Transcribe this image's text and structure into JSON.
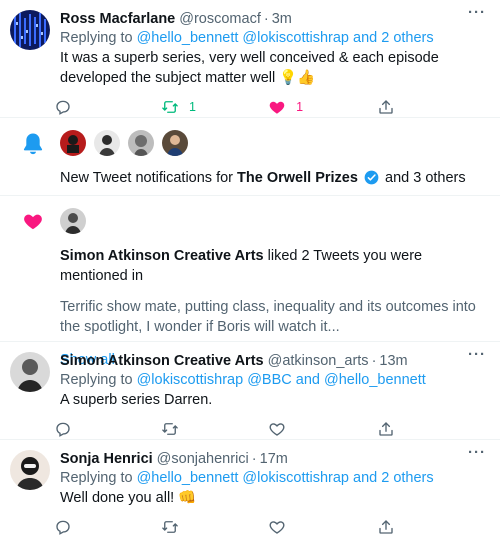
{
  "tweets": [
    {
      "name": "Ross Macfarlane",
      "handle": "@roscomacf",
      "time": "3m",
      "replying_prefix": "Replying to",
      "replying_to": "@hello_bennett @lokiscottishrap and 2 others",
      "text": "It was a superb series, very well conceived & each episode developed the subject matter well 💡👍",
      "retweets": "1",
      "likes": "1"
    },
    {
      "name": "Simon Atkinson Creative Arts",
      "handle": "@atkinson_arts",
      "time": "13m",
      "replying_prefix": "Replying to",
      "replying_to": "@lokiscottishrap @BBC and @hello_bennett",
      "text": "A superb series Darren."
    },
    {
      "name": "Sonja Henrici",
      "handle": "@sonjahenrici",
      "time": "17m",
      "replying_prefix": "Replying to",
      "replying_to": "@hello_bennett @lokiscottishrap and 2 others",
      "text": "Well done you all! 👊"
    }
  ],
  "notif_bell": {
    "prefix": "New Tweet notifications for",
    "account": "The Orwell Prizes",
    "suffix": "and 3 others"
  },
  "notif_like": {
    "actor": "Simon Atkinson Creative Arts",
    "action": "liked 2 Tweets you were mentioned in",
    "preview": "Terrific show mate, putting class, inequality and its outcomes into the spotlight, I wonder if Boris will watch it...",
    "show_all": "Show all"
  },
  "more_glyph": "···",
  "sep": "·",
  "colors": {
    "accent": "#1d9bf0",
    "like": "#f91880",
    "retweet": "#00ba7c",
    "muted": "#536471"
  }
}
